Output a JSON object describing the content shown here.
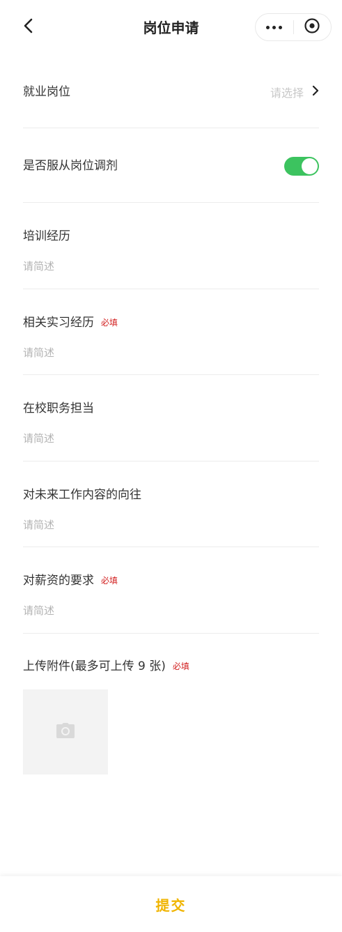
{
  "header": {
    "title": "岗位申请",
    "back_icon": "chevron-left-icon",
    "more_icon": "more-dots-icon",
    "close_icon": "close-circle-icon"
  },
  "form": {
    "job": {
      "label": "就业岗位",
      "placeholder": "请选择"
    },
    "obey_adjust": {
      "label": "是否服从岗位调剂",
      "enabled": true
    },
    "training": {
      "label": "培训经历",
      "placeholder": "请简述"
    },
    "internship": {
      "label": "相关实习经历",
      "required": "必填",
      "placeholder": "请简述"
    },
    "campus_role": {
      "label": "在校职务担当",
      "placeholder": "请简述"
    },
    "future_work": {
      "label": "对未来工作内容的向往",
      "placeholder": "请简述"
    },
    "salary": {
      "label": "对薪资的要求",
      "required": "必填",
      "placeholder": "请简述"
    },
    "upload": {
      "label": "上传附件(最多可上传 9 张)",
      "required": "必填",
      "icon": "camera-icon"
    }
  },
  "footer": {
    "submit_label": "提交"
  },
  "colors": {
    "toggle_on": "#3cc35f",
    "required": "#d21f1f",
    "submit": "#f0b400"
  }
}
